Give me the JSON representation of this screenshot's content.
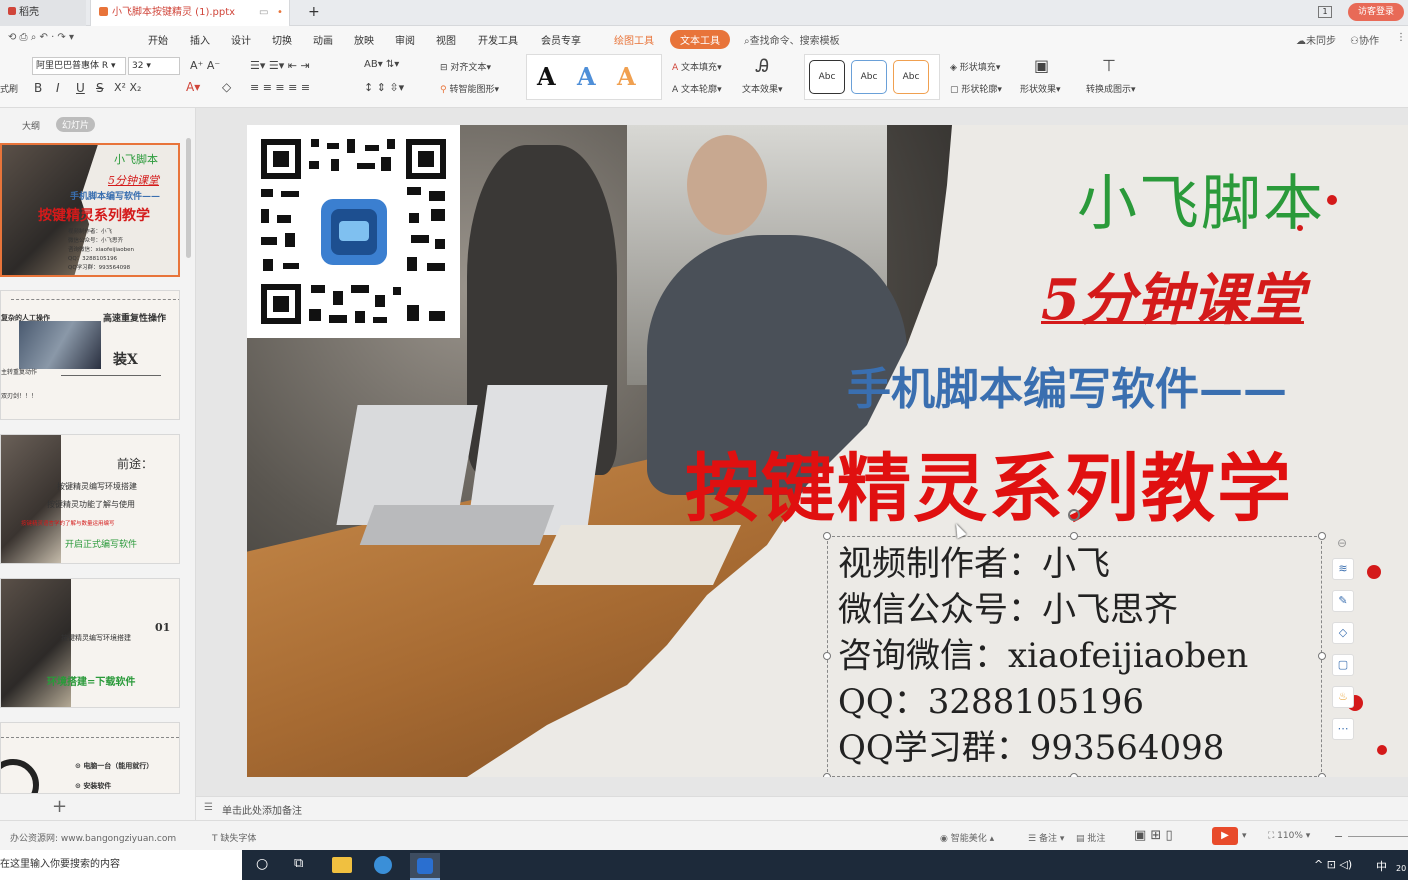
{
  "titlebar": {
    "home_tab": "稻壳",
    "doc_tab": "小飞脚本按键精灵 (1).pptx",
    "new_tab": "+",
    "login_button": "访客登录"
  },
  "menubar": {
    "items": [
      "开始",
      "插入",
      "设计",
      "切换",
      "动画",
      "放映",
      "审阅",
      "视图",
      "开发工具",
      "会员专享",
      "绘图工具",
      "文本工具"
    ],
    "search_placeholder": "查找命令、搜索模板",
    "unsynced": "未同步",
    "collab": "协作"
  },
  "ribbon": {
    "format_painter": "式刷",
    "font_name": "阿里巴巴普惠体 R",
    "font_size": "32",
    "align_text": "对齐文本",
    "smartart": "转智能图形",
    "text_fill": "文本填充",
    "text_outline": "文本轮廓",
    "text_effect": "文本效果",
    "shape_fill": "形状填充",
    "shape_outline": "形状轮廓",
    "shape_effect": "形状效果",
    "convert_figure": "转换成图示",
    "style_letter": "A",
    "abc": "Abc",
    "colors": {
      "accent_orange": "#e8743a",
      "text_tool_bg": "#e8743a"
    }
  },
  "leftpanel": {
    "outline_tab": "大纲",
    "slides_tab": "幻灯片",
    "add_button": "+",
    "thumb1": {
      "title1": "小飞脚本",
      "title2": "5分钟课堂",
      "title3": "手机脚本编写软件——",
      "title4": "按键精灵系列教学",
      "lines": [
        "视频制作者：小飞",
        "微信公众号：小飞思齐",
        "咨询微信：xiaofeijiaoben",
        "QQ：3288105196",
        "QQ学习群：993564098"
      ]
    },
    "thumb2": {
      "text1": "复杂的人工操作",
      "text2": "高速重复性操作",
      "text3": "装X",
      "text4": "主转重复动作",
      "text5": "双刃剑！！！"
    },
    "thumb3": {
      "title": "前途：",
      "items": [
        "按键精灵编写环境搭建",
        "按键精灵功能了解与使用",
        "按键精灵语言学的了解与数量运用编写",
        "开启正式编写软件"
      ]
    },
    "thumb4": {
      "num": "01",
      "text1": "按键精灵编写环境搭建",
      "text2": "环境搭建=下载软件"
    },
    "thumb5": {
      "text1": "电脑一台（能用就行）",
      "text2": "安装软件"
    }
  },
  "slide": {
    "brand": "小飞脚本",
    "subtitle": "5分钟课堂",
    "heading": "手机脚本编写软件——",
    "title": "按键精灵系列教学",
    "info_lines": [
      "视频制作者：小飞",
      "微信公众号：小飞思齐",
      "咨询微信：xiaofeijiaoben",
      "QQ：3288105196",
      "QQ学习群：993564098"
    ]
  },
  "notes": {
    "placeholder": "单击此处添加备注"
  },
  "statusbar": {
    "source": "办公资源网: www.bangongziyuan.com",
    "missing_font": "缺失字体",
    "smart_beautify": "智能美化",
    "notes": "备注",
    "comments": "批注",
    "zoom": "110%"
  },
  "taskbar": {
    "search_placeholder": "在这里输入你要搜索的内容",
    "ime": "中",
    "year_fragment": "20"
  }
}
